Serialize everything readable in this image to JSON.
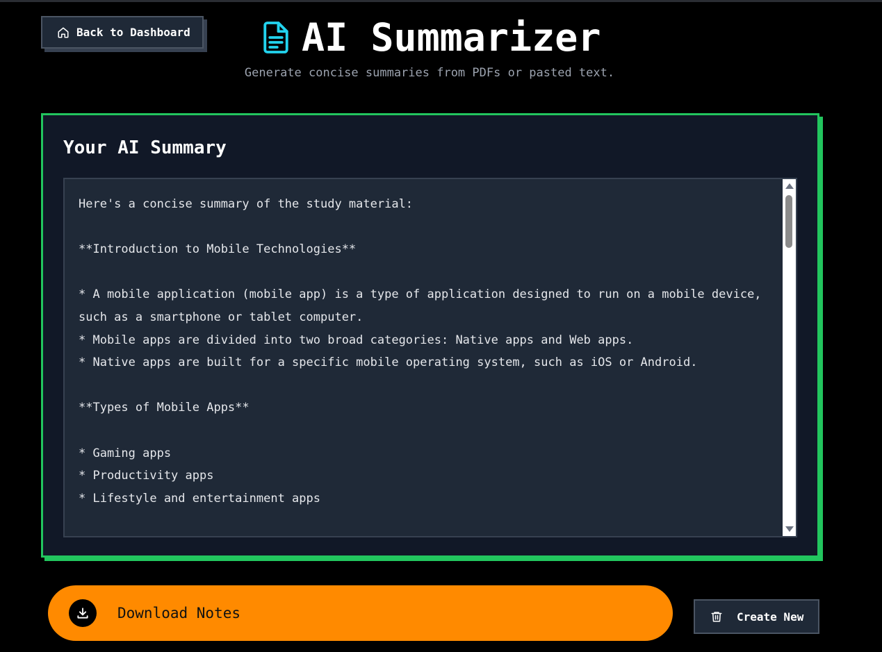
{
  "nav": {
    "back_label": "Back to Dashboard"
  },
  "header": {
    "title": "AI Summarizer",
    "subtitle": "Generate concise summaries from PDFs or pasted text."
  },
  "summary": {
    "heading": "Your AI Summary",
    "text": "Here's a concise summary of the study material:\n\n**Introduction to Mobile Technologies**\n\n* A mobile application (mobile app) is a type of application designed to run on a mobile device, such as a smartphone or tablet computer.\n* Mobile apps are divided into two broad categories: Native apps and Web apps.\n* Native apps are built for a specific mobile operating system, such as iOS or Android.\n\n**Types of Mobile Apps**\n\n* Gaming apps\n* Productivity apps\n* Lifestyle and entertainment apps"
  },
  "actions": {
    "download_label": "Download Notes",
    "create_label": "Create New"
  },
  "colors": {
    "accent_green": "#22c55e",
    "download_orange": "#ff8a00",
    "icon_cyan": "#22d3ee"
  },
  "icons": {
    "back": "home-icon",
    "title": "document-icon",
    "download": "download-icon",
    "create": "trash-icon"
  }
}
